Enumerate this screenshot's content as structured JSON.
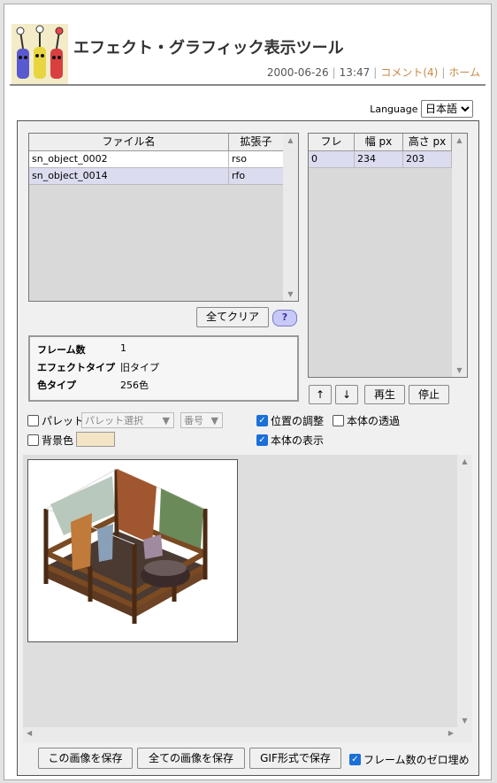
{
  "header": {
    "title": "エフェクト・グラフィック表示ツール",
    "date": "2000-06-26",
    "time": "13:47",
    "comment_link": "コメント(4)",
    "home_link": "ホーム"
  },
  "language": {
    "label": "Language",
    "selected": "日本語"
  },
  "file_list": {
    "columns": [
      "ファイル名",
      "拡張子"
    ],
    "rows": [
      {
        "name": "sn_object_0002",
        "ext": "rso"
      },
      {
        "name": "sn_object_0014",
        "ext": "rfo"
      }
    ]
  },
  "clear_all_button": "全てクリア",
  "help_button": "?",
  "info": {
    "frames_label": "フレーム数",
    "frames_value": "1",
    "effect_type_label": "エフェクトタイプ",
    "effect_type_value": "旧タイプ",
    "color_type_label": "色タイプ",
    "color_type_value": "256色"
  },
  "frame_list": {
    "columns": [
      "フレ",
      "幅 px",
      "高さ px"
    ],
    "rows": [
      {
        "frame": "0",
        "width": "234",
        "height": "203"
      }
    ]
  },
  "controls": {
    "up": "↑",
    "down": "↓",
    "play": "再生",
    "stop": "停止",
    "palette_label": "パレット",
    "palette_select": "パレット選択",
    "number_select": "番号",
    "bg_color_label": "背景色",
    "position_adjust": "位置の調整",
    "body_transparent": "本体の透過",
    "body_display": "本体の表示"
  },
  "bottom": {
    "save_image": "この画像を保存",
    "save_all": "全ての画像を保存",
    "save_gif": "GIF形式で保存",
    "zero_pad": "フレーム数のゼロ埋め"
  },
  "colors": {
    "accent_link": "#c98a45",
    "selected_row": "#dcdcf0",
    "checkbox": "#1a6fd8",
    "bg_swatch": "#f2e4c5"
  }
}
